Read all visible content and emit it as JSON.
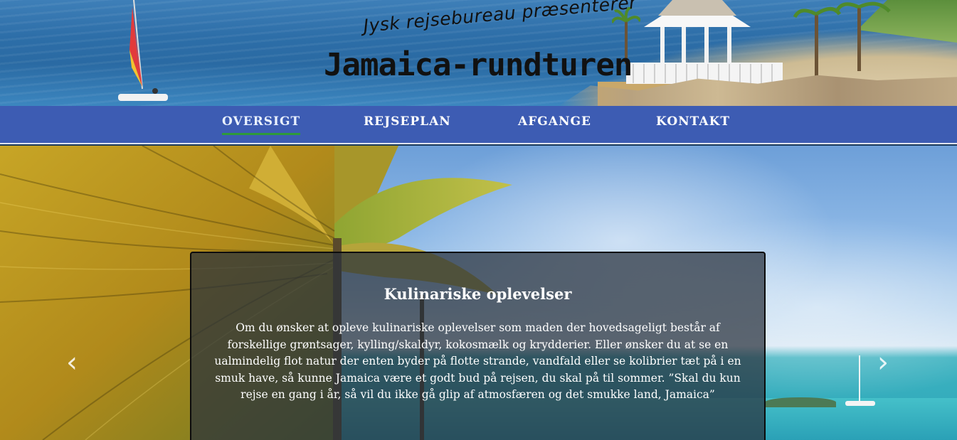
{
  "header": {
    "tagline": "Jysk rejsebureau præsenterer",
    "title": "Jamaica-rundturen"
  },
  "nav": {
    "items": [
      {
        "label": "OVERSIGT",
        "active": true
      },
      {
        "label": "REJSEPLAN",
        "active": false
      },
      {
        "label": "AFGANGE",
        "active": false
      },
      {
        "label": "KONTAKT",
        "active": false
      }
    ],
    "active_underline_color": "#2e9a3a",
    "background_color": "#3d5cb3"
  },
  "carousel": {
    "prev_icon": "chevron-left-icon",
    "next_icon": "chevron-right-icon",
    "slide": {
      "title": "Kulinariske oplevelser",
      "text": "Om du ønsker at opleve kulinariske oplevelser som maden der hovedsageligt består af forskellige grøntsager, kylling/skaldyr, kokosmælk og krydderier. Eller ønsker du at se en ualmindelig flot natur der enten byder på flotte strande, vandfald eller se kolibrier tæt på i en smuk have, så kunne Jamaica være et godt bud på rejsen, du skal på til sommer. ”Skal du kun rejse en gang i år, så vil du ikke gå glip af atmosfæren og det smukke land, Jamaica”"
    }
  }
}
